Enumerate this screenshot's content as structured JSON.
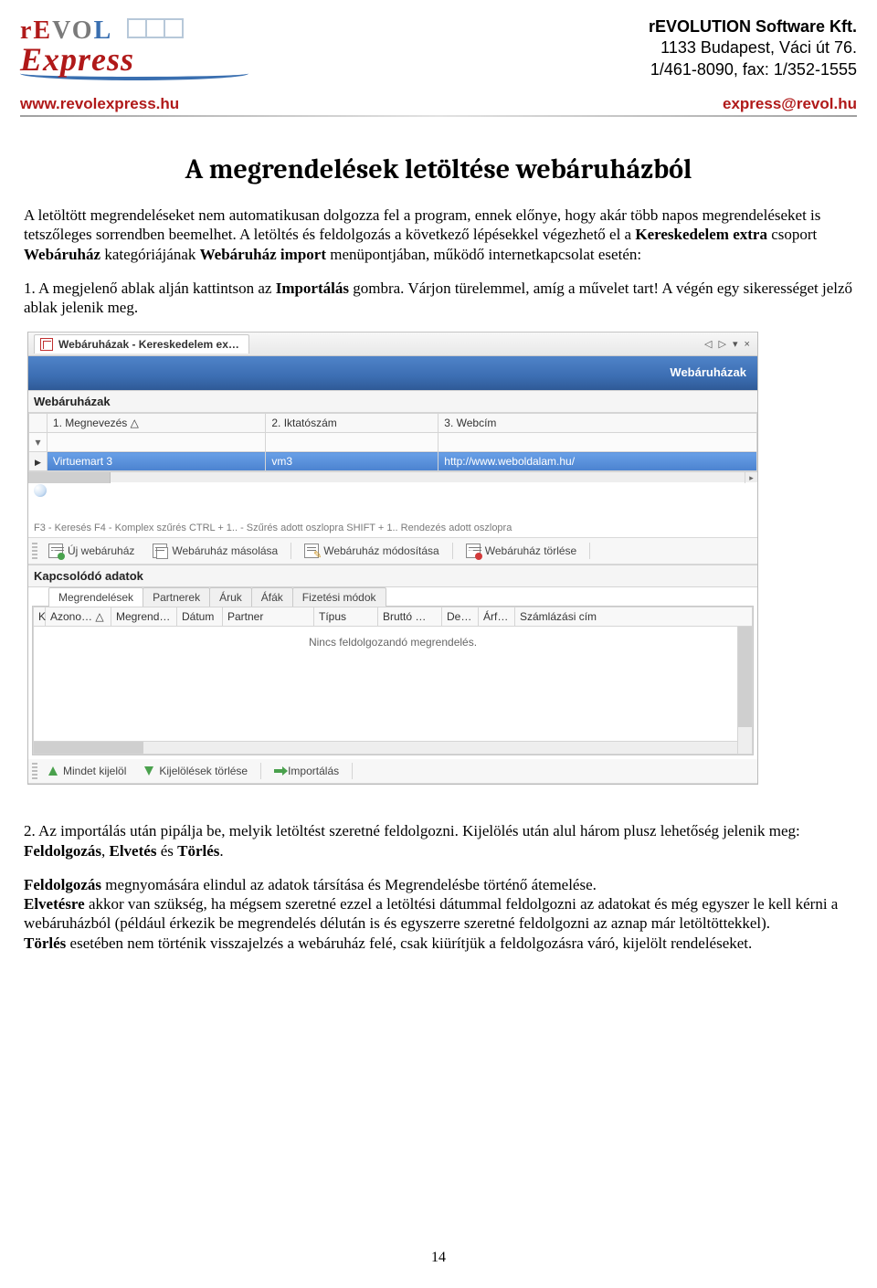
{
  "header": {
    "company_name": "rEVOLUTION Software Kft.",
    "address": "1133 Budapest, Váci út 76.",
    "contact": "1/461-8090, fax: 1/352-1555",
    "website": "www.revolexpress.hu",
    "email": "express@revol.hu",
    "logo_revol_re": "rE",
    "logo_revol_vo": "VO",
    "logo_revol_l": "L",
    "logo_express": "Express"
  },
  "doc": {
    "title": "A megrendelések letöltése webáruházból",
    "p1": "A letöltött megrendeléseket nem automatikusan dolgozza fel a program, ennek előnye, hogy akár több napos megrendeléseket is tetszőleges sorrendben beemelhet. A letöltés és feldolgozás a következő lépésekkel végezhető el a ",
    "p1_b1": "Kereskedelem extra",
    "p1_m": " csoport ",
    "p1_b2": "Webáruház",
    "p1_m2": " kategóriájának ",
    "p1_b3": "Webáruház import",
    "p1_end": " menüpontjában, működő internetkapcsolat esetén:",
    "li1_a": "1. A megjelenő ablak alján kattintson az ",
    "li1_b": "Importálás",
    "li1_c": " gombra. Várjon türelemmel, amíg a művelet tart! A végén egy sikerességet jelző ablak jelenik meg.",
    "p2_a": "2. Az importálás után pipálja be, melyik letöltést szeretné feldolgozni. Kijelölés után alul három plusz lehetőség jelenik meg: ",
    "p2_b1": "Feldolgozás",
    "p2_m1": ", ",
    "p2_b2": "Elvetés",
    "p2_m2": " és ",
    "p2_b3": "Törlés",
    "p2_end": ".",
    "p3_a": "Feldolgozás",
    "p3_b": " megnyomására elindul az adatok társítása és Megrendelésbe történő átemelése.",
    "p4_a": "Elvetésre",
    "p4_b": " akkor van szükség, ha mégsem szeretné ezzel a letöltési dátummal feldolgozni az adatokat és még egyszer le kell kérni a webáruházból (például érkezik be megrendelés délután is és egyszerre szeretné feldolgozni az aznap már letöltöttekkel).",
    "p5_a": "Törlés",
    "p5_b": " esetében nem történik visszajelzés a webáruház felé, csak kiürítjük a feldolgozásra váró, kijelölt rendeléseket.",
    "page_number": "14"
  },
  "app": {
    "tab_title": "Webáruházak - Kereskedelem ex…",
    "wincontrols": "◁ ▷ ▾ ×",
    "banner": "Webáruházak",
    "section_head": "Webáruházak",
    "columns": {
      "c1": "1. Megnevezés △",
      "c2": "2. Iktatószám",
      "c3": "3. Webcím"
    },
    "row": {
      "name": "Virtuemart 3",
      "reg": "vm3",
      "url": "http://www.weboldalam.hu/"
    },
    "hints": "F3 - Keresés   F4 - Komplex szűrés   CTRL + 1.. - Szűrés adott oszlopra   SHIFT + 1.. Rendezés adott oszlopra",
    "tb": {
      "new": "Új webáruház",
      "copy": "Webáruház másolása",
      "edit": "Webáruház módosítása",
      "del": "Webáruház törlése"
    },
    "related_head": "Kapcsolódó adatok",
    "tabs": {
      "t1": "Megrendelések",
      "t2": "Partnerek",
      "t3": "Áruk",
      "t4": "Áfák",
      "t5": "Fizetési módok"
    },
    "ocols": {
      "c0": "K",
      "c1": "Azono… △",
      "c2": "Megrend…",
      "c3": "Dátum",
      "c4": "Partner",
      "c5": "Típus",
      "c6": "Bruttó …",
      "c7": "De…",
      "c8": "Árf…",
      "c9": "Számlázási cím"
    },
    "empty": "Nincs feldolgozandó megrendelés.",
    "bottom": {
      "selall": "Mindet kijelöl",
      "clear": "Kijelölések törlése",
      "import": "Importálás"
    }
  }
}
